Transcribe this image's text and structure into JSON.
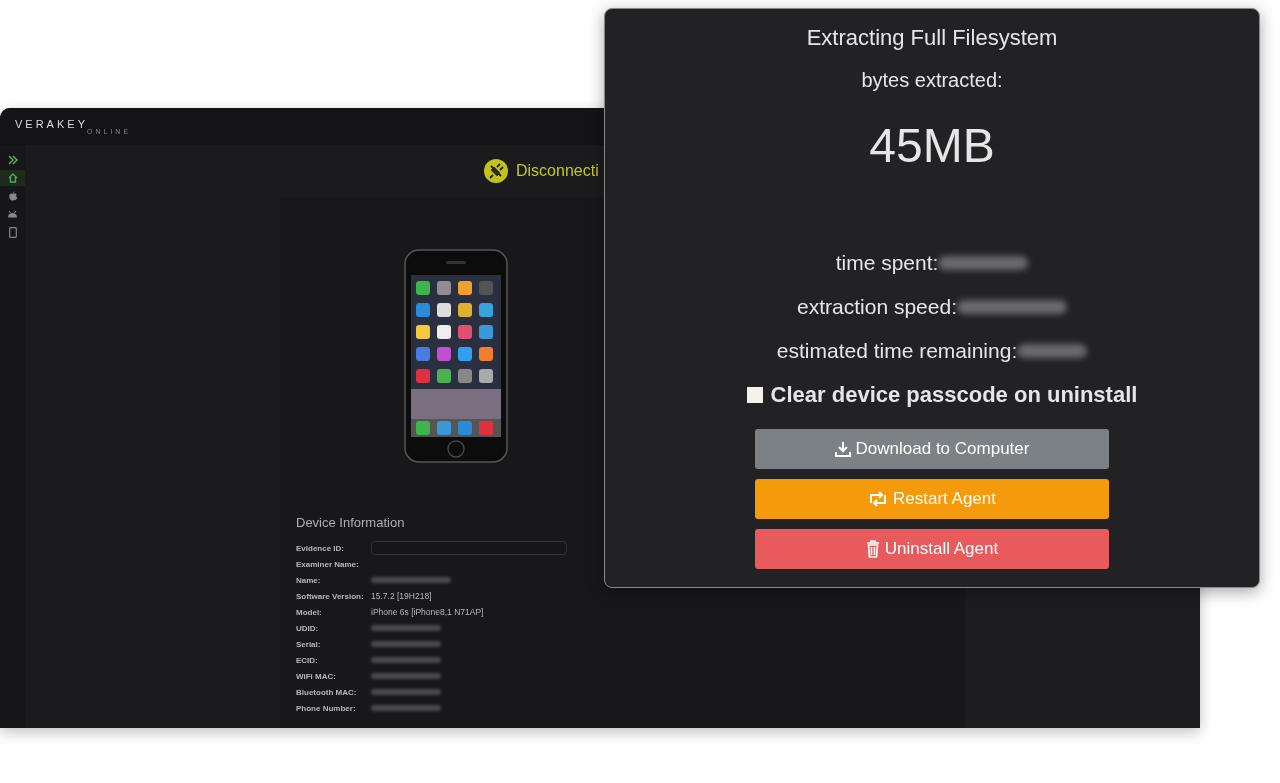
{
  "back_window": {
    "logo": {
      "name": "VERAKEY",
      "sub": "ONLINE"
    },
    "sidebar": {
      "items": [
        {
          "kind": "expand",
          "selected": false
        },
        {
          "kind": "home",
          "selected": true
        },
        {
          "kind": "apple",
          "selected": false
        },
        {
          "kind": "android",
          "selected": false
        },
        {
          "kind": "phone",
          "selected": false
        }
      ]
    },
    "status": "Disconnecti",
    "device_information": {
      "title": "Device Information",
      "rows": [
        {
          "label": "Evidence ID:",
          "kind": "field"
        },
        {
          "label": "Examiner Name:",
          "kind": "empty"
        },
        {
          "label": "Name:",
          "kind": "redacted"
        },
        {
          "label": "Software Version:",
          "kind": "text",
          "value": "15.7.2 [19H218]"
        },
        {
          "label": "Model:",
          "kind": "text",
          "value": "iPhone 6s [iPhone8,1 N71AP]"
        },
        {
          "label": "UDID:",
          "kind": "redacted"
        },
        {
          "label": "Serial:",
          "kind": "redacted"
        },
        {
          "label": "ECID:",
          "kind": "redacted"
        },
        {
          "label": "WiFi MAC:",
          "kind": "redacted"
        },
        {
          "label": "Bluetooth MAC:",
          "kind": "redacted"
        },
        {
          "label": "Phone Number:",
          "kind": "redacted"
        }
      ]
    }
  },
  "extraction_panel": {
    "title": "Extracting Full Filesystem",
    "bytes_label": "bytes extracted:",
    "bytes_value": "45MB",
    "stats": [
      {
        "label": "time spent:"
      },
      {
        "label": "extraction speed:"
      },
      {
        "label": "estimated time remaining:"
      }
    ],
    "checkbox": {
      "label": "Clear device passcode on uninstall",
      "checked": false
    },
    "buttons": [
      {
        "kind": "download",
        "label": "Download to Computer"
      },
      {
        "kind": "restart",
        "label": "Restart Agent"
      },
      {
        "kind": "uninstall",
        "label": "Uninstall Agent"
      }
    ]
  }
}
